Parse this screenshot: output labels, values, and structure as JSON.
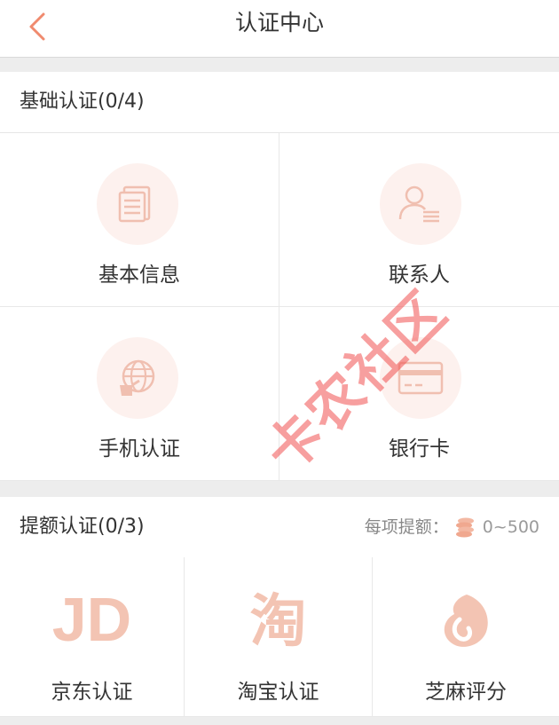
{
  "header": {
    "title": "认证中心",
    "back_icon": "chevron-left-icon"
  },
  "basic": {
    "title": "基础认证(0/4)",
    "items": [
      {
        "label": "基本信息",
        "icon": "document-icon"
      },
      {
        "label": "联系人",
        "icon": "contact-icon"
      },
      {
        "label": "手机认证",
        "icon": "globe-phone-icon"
      },
      {
        "label": "银行卡",
        "icon": "bank-card-icon"
      }
    ]
  },
  "extra": {
    "title": "提额认证(0/3)",
    "quota_label": "每项提额：",
    "quota_value": "0~500",
    "quota_icon": "coins-icon",
    "items": [
      {
        "label": "京东认证",
        "icon": "jd-logo-icon",
        "logo_text": "JD"
      },
      {
        "label": "淘宝认证",
        "icon": "taobao-logo-icon",
        "logo_text": "淘"
      },
      {
        "label": "芝麻评分",
        "icon": "sesame-logo-icon"
      }
    ]
  },
  "watermark": {
    "text": "卡农社区"
  },
  "colors": {
    "accent": "#f08a6e",
    "icon_bg": "#fdf1ee",
    "icon_fg": "#f3c2b4",
    "divider": "#ededed"
  }
}
